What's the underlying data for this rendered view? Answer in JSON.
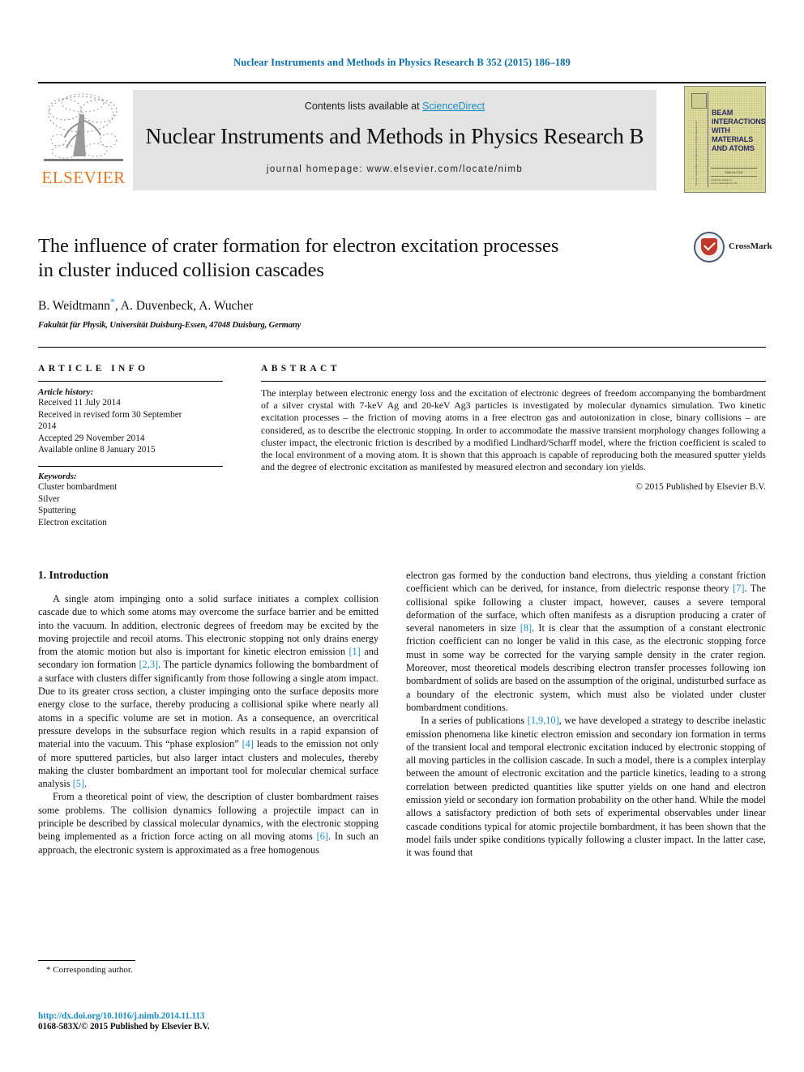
{
  "running_head": "Nuclear Instruments and Methods in Physics Research B 352 (2015) 186–189",
  "masthead": {
    "contents_prefix": "Contents lists available at ",
    "sciencedirect": "ScienceDirect",
    "journal_title": "Nuclear Instruments and Methods in Physics Research B",
    "homepage": "journal homepage: www.elsevier.com/locate/nimb",
    "publisher_logo_text": "ELSEVIER",
    "cover": {
      "title_lines": [
        "BEAM",
        "INTERACTIONS",
        "WITH",
        "MATERIALS",
        "AND ATOMS"
      ],
      "spine_text": "Nuclear Instruments and Methods in Physics Research B",
      "footer_center": "Editor-in-Chief",
      "footer_bottom": "Available online at www.sciencedirect.com"
    }
  },
  "article": {
    "title_line1": "The influence of crater formation for electron excitation processes",
    "title_line2": "in cluster induced collision cascades",
    "authors": "B. Weidtmann",
    "authors_rest": ", A. Duvenbeck, A. Wucher",
    "corresponding_marker": "*",
    "affiliation": "Fakultät für Physik, Universität Duisburg-Essen, 47048 Duisburg, Germany",
    "crossmark_label": "CrossMark"
  },
  "article_info": {
    "heading": "ARTICLE INFO",
    "history_label": "Article history:",
    "history": [
      "Received 11 July 2014",
      "Received in revised form 30 September",
      "2014",
      "Accepted 29 November 2014",
      "Available online 8 January 2015"
    ],
    "keywords_label": "Keywords:",
    "keywords": [
      "Cluster bombardment",
      "Silver",
      "Sputtering",
      "Electron excitation"
    ]
  },
  "abstract": {
    "heading": "ABSTRACT",
    "text": "The interplay between electronic energy loss and the excitation of electronic degrees of freedom accompanying the bombardment of a silver crystal with 7-keV Ag and 20-keV Ag3 particles is investigated by molecular dynamics simulation. Two kinetic excitation processes – the friction of moving atoms in a free electron gas and autoionization in close, binary collisions – are considered, as to describe the electronic stopping. In order to accommodate the massive transient morphology changes following a cluster impact, the electronic friction is described by a modified Lindhard/Scharff model, where the friction coefficient is scaled to the local environment of a moving atom. It is shown that this approach is capable of reproducing both the measured sputter yields and the degree of electronic excitation as manifested by measured electron and secondary ion yields.",
    "copyright": "© 2015 Published by Elsevier B.V."
  },
  "body": {
    "section_title": "1. Introduction",
    "left_para1_a": "A single atom impinging onto a solid surface initiates a complex collision cascade due to which some atoms may overcome the surface barrier and be emitted into the vacuum. In addition, electronic degrees of freedom may be excited by the moving projectile and recoil atoms. This electronic stopping not only drains energy from the atomic motion but also is important for kinetic electron emission ",
    "left_ref1": "[1]",
    "left_para1_b": " and secondary ion formation ",
    "left_ref2": "[2,3]",
    "left_para1_c": ". The particle dynamics following the bombardment of a surface with clusters differ significantly from those following a single atom impact. Due to its greater cross section, a cluster impinging onto the surface deposits more energy close to the surface, thereby producing a collisional spike where nearly all atoms in a specific volume are set in motion. As a consequence, an overcritical pressure develops in the subsurface region which results in a rapid expansion of material into the vacuum. This “phase explosion” ",
    "left_ref3": "[4]",
    "left_para1_d": " leads to the emission not only of more sputtered particles, but also larger intact clusters and molecules, thereby making the cluster bombardment an important tool for molecular chemical surface analysis ",
    "left_ref4": "[5]",
    "left_para1_e": ".",
    "left_para2_a": "From a theoretical point of view, the description of cluster bombardment raises some problems. The collision dynamics following a projectile impact can in principle be described by classical molecular dynamics, with the electronic stopping being implemented as a friction force acting on all moving atoms ",
    "left_ref5": "[6]",
    "left_para2_b": ". In such an approach, the electronic system is approximated as a free homogenous",
    "right_para1_a": "electron gas formed by the conduction band electrons, thus yielding a constant friction coefficient which can be derived, for instance, from dielectric response theory ",
    "right_ref1": "[7]",
    "right_para1_b": ". The collisional spike following a cluster impact, however, causes a severe temporal deformation of the surface, which often manifests as a disruption producing a crater of several nanometers in size ",
    "right_ref2": "[8]",
    "right_para1_c": ". It is clear that the assumption of a constant electronic friction coefficient can no longer be valid in this case, as the electronic stopping force must in some way be corrected for the varying sample density in the crater region. Moreover, most theoretical models describing electron transfer processes following ion bombardment of solids are based on the assumption of the original, undisturbed surface as a boundary of the electronic system, which must also be violated under cluster bombardment conditions.",
    "right_para2_a": "In a series of publications ",
    "right_ref3": "[1,9,10]",
    "right_para2_b": ", we have developed a strategy to describe inelastic emission phenomena like kinetic electron emission and secondary ion formation in terms of the transient local and temporal electronic excitation induced by electronic stopping of all moving particles in the collision cascade. In such a model, there is a complex interplay between the amount of electronic excitation and the particle kinetics, leading to a strong correlation between predicted quantities like sputter yields on one hand and electron emission yield or secondary ion formation probability on the other hand. While the model allows a satisfactory prediction of both sets of experimental observables under linear cascade conditions typical for atomic projectile bombardment, it has been shown that the model fails under spike conditions typically following a cluster impact. In the latter case, it was found that"
  },
  "footer": {
    "corresponding_note": "* Corresponding author.",
    "doi": "http://dx.doi.org/10.1016/j.nimb.2014.11.113",
    "issn": "0168-583X/© 2015 Published by Elsevier B.V."
  },
  "colors": {
    "link": "#1a8ec4",
    "running_head": "#0a6ea8",
    "elsevier_orange": "#E87722",
    "band_grey": "#e3e3e3",
    "cover_yellow": "#dedca0",
    "cover_blue": "#2d2d66",
    "crossmark_red": "#c0392b"
  }
}
